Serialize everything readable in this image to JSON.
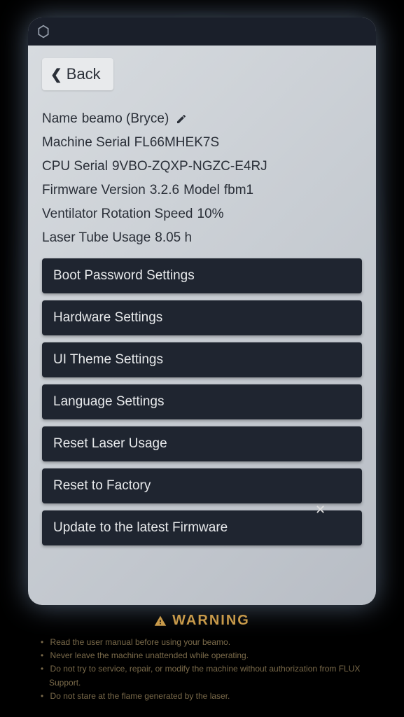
{
  "back_label": "Back",
  "info": {
    "name_label": "Name",
    "name_value": "beamo (Bryce)",
    "machine_serial_label": "Machine Serial",
    "machine_serial_value": "FL66MHEK7S",
    "cpu_serial_label": "CPU Serial",
    "cpu_serial_value": "9VBO-ZQXP-NGZC-E4RJ",
    "firmware_label": "Firmware Version",
    "firmware_value": "3.2.6",
    "model_label": "Model",
    "model_value": "fbm1",
    "ventilator_label": "Ventilator Rotation Speed",
    "ventilator_value": "10%",
    "laser_usage_label": "Laser Tube Usage",
    "laser_usage_value": "8.05 h"
  },
  "menu": {
    "boot_password": "Boot Password Settings",
    "hardware": "Hardware Settings",
    "ui_theme": "UI Theme Settings",
    "language": "Language Settings",
    "reset_laser": "Reset Laser Usage",
    "reset_factory": "Reset to Factory",
    "update_firmware": "Update to the latest Firmware"
  },
  "warning": {
    "title": "WARNING",
    "items": [
      "Read the user manual before using your beamo.",
      "Never leave the machine unattended while operating.",
      "Do not try to service, repair, or modify the machine without authorization from FLUX Support.",
      "Do not stare at the flame generated by the laser."
    ]
  }
}
